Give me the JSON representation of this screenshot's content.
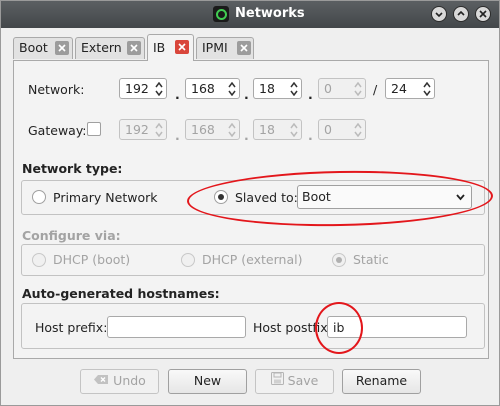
{
  "window": {
    "title": "Networks"
  },
  "tabs": [
    {
      "label": "Boot"
    },
    {
      "label": "Extern"
    },
    {
      "label": "IB"
    },
    {
      "label": "IPMI"
    }
  ],
  "network": {
    "label": "Network:",
    "octets": [
      "192",
      "168",
      "18",
      "0"
    ],
    "slash": "/",
    "mask": "24",
    "dot": "."
  },
  "gateway": {
    "label": "Gateway:",
    "checked": false,
    "octets": [
      "192",
      "168",
      "18",
      "0"
    ]
  },
  "network_type": {
    "heading": "Network type:",
    "primary_label": "Primary Network",
    "slaved_label": "Slaved to:",
    "slaved_value": "Boot",
    "selected": "slaved"
  },
  "configure": {
    "heading": "Configure via:",
    "options": [
      "DHCP (boot)",
      "DHCP (external)",
      "Static"
    ],
    "selected": "Static"
  },
  "hostnames": {
    "heading": "Auto-generated hostnames:",
    "prefix_label": "Host prefix:",
    "prefix_value": "",
    "postfix_label": "Host postfix",
    "postfix_value": "ib"
  },
  "buttons": {
    "undo": "Undo",
    "new": "New",
    "save": "Save",
    "rename": "Rename"
  },
  "colors": {
    "annotation": "#e3161b",
    "active_tab_close": "#d9463b",
    "titlebar": "#4a4e51"
  }
}
